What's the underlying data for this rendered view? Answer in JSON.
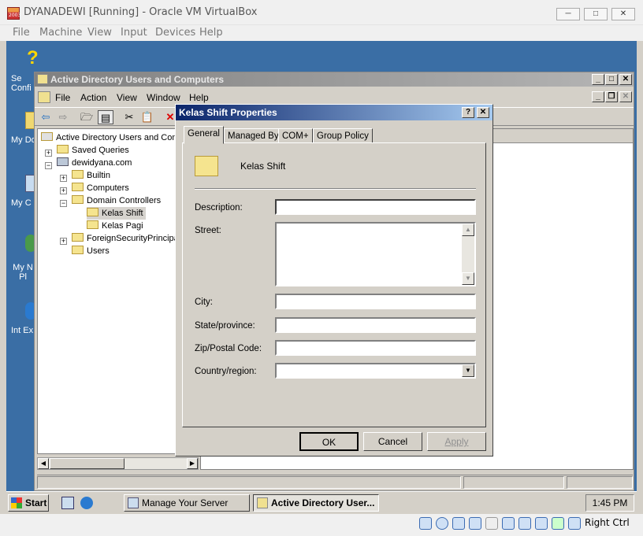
{
  "host": {
    "title": "DYANADEWI [Running] - Oracle VM VirtualBox",
    "menu": [
      "File",
      "Machine",
      "View",
      "Input",
      "Devices",
      "Help"
    ],
    "status_right": "Right Ctrl"
  },
  "desktop": {
    "icons": [
      "Se Confi",
      "My Do",
      "My C",
      "My N Pl",
      "Int Ex"
    ]
  },
  "aduc": {
    "title": "Active Directory Users and Computers",
    "menu": [
      "File",
      "Action",
      "View",
      "Window",
      "Help"
    ],
    "tree": {
      "root": "Active Directory Users and Com",
      "saved_queries": "Saved Queries",
      "domain": "dewidyana.com",
      "builtin": "Builtin",
      "computers": "Computers",
      "domain_controllers": "Domain Controllers",
      "kelas_shift": "Kelas Shift",
      "kelas_pagi": "Kelas Pagi",
      "foreign": "ForeignSecurityPrincipal",
      "users": "Users"
    }
  },
  "dialog": {
    "title": "Kelas Shift Properties",
    "tabs": [
      "General",
      "Managed By",
      "COM+",
      "Group Policy"
    ],
    "object_name": "Kelas Shift",
    "labels": {
      "description": "Description:",
      "street": "Street:",
      "city": "City:",
      "state": "State/province:",
      "zip": "Zip/Postal Code:",
      "country": "Country/region:"
    },
    "values": {
      "description": "",
      "street": "",
      "city": "",
      "state": "",
      "zip": "",
      "country": ""
    },
    "buttons": {
      "ok": "OK",
      "cancel": "Cancel",
      "apply": "Apply"
    }
  },
  "taskbar": {
    "start": "Start",
    "tasks": [
      "Manage Your Server",
      "Active Directory User..."
    ],
    "clock": "1:45 PM"
  }
}
